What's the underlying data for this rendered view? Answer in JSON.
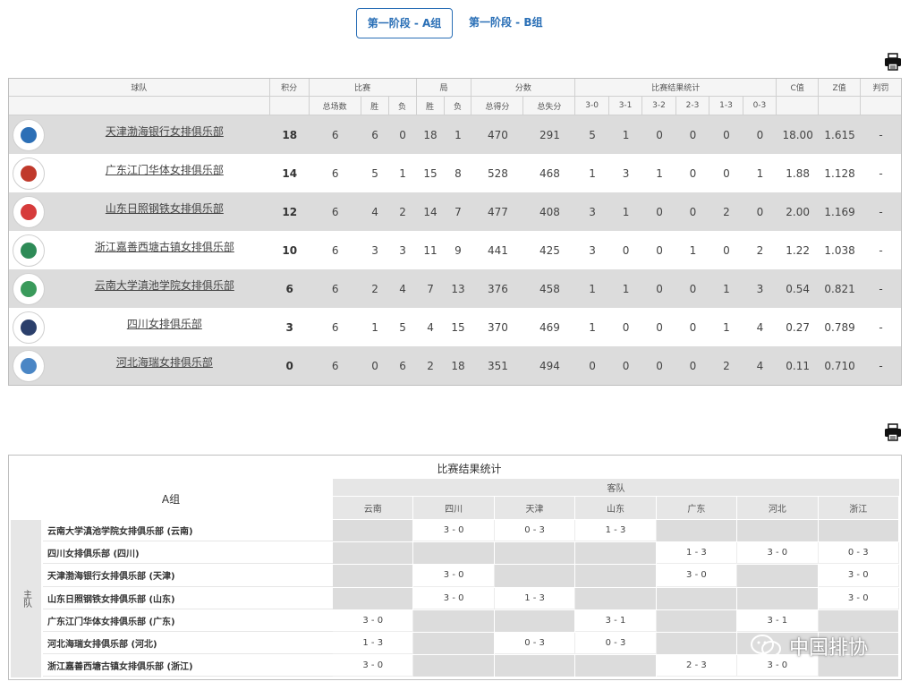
{
  "tabs": [
    {
      "label": "第一阶段 - A组",
      "active": true
    },
    {
      "label": "第一阶段 - B组",
      "active": false
    }
  ],
  "standings": {
    "headers_top": {
      "team": "球队",
      "points": "积分",
      "matches": "比赛",
      "games": "局",
      "score": "分数",
      "results": "比赛结果统计",
      "c": "C值",
      "z": "Z值",
      "penalty": "判罚"
    },
    "headers_sub": {
      "total": "总场数",
      "win": "胜",
      "lose": "负",
      "gwin": "胜",
      "glose": "负",
      "pts_for": "总得分",
      "pts_against": "总失分",
      "r30": "3-0",
      "r31": "3-1",
      "r32": "3-2",
      "r23": "2-3",
      "r13": "1-3",
      "r03": "0-3"
    },
    "rows": [
      {
        "team": "天津渤海银行女排俱乐部",
        "pts": "18",
        "total": "6",
        "w": "6",
        "l": "0",
        "gw": "18",
        "gl": "1",
        "pf": "470",
        "pa": "291",
        "r30": "5",
        "r31": "1",
        "r32": "0",
        "r23": "0",
        "r13": "0",
        "r03": "0",
        "c": "18.00",
        "z": "1.615",
        "pen": "-",
        "logo_color": "#2c6fb6"
      },
      {
        "team": "广东江门华体女排俱乐部",
        "pts": "14",
        "total": "6",
        "w": "5",
        "l": "1",
        "gw": "15",
        "gl": "8",
        "pf": "528",
        "pa": "468",
        "r30": "1",
        "r31": "3",
        "r32": "1",
        "r23": "0",
        "r13": "0",
        "r03": "1",
        "c": "1.88",
        "z": "1.128",
        "pen": "-",
        "logo_color": "#c0392b"
      },
      {
        "team": "山东日照钢铁女排俱乐部",
        "pts": "12",
        "total": "6",
        "w": "4",
        "l": "2",
        "gw": "14",
        "gl": "7",
        "pf": "477",
        "pa": "408",
        "r30": "3",
        "r31": "1",
        "r32": "0",
        "r23": "0",
        "r13": "2",
        "r03": "0",
        "c": "2.00",
        "z": "1.169",
        "pen": "-",
        "logo_color": "#d63b3b"
      },
      {
        "team": "浙江嘉善西塘古镇女排俱乐部",
        "pts": "10",
        "total": "6",
        "w": "3",
        "l": "3",
        "gw": "11",
        "gl": "9",
        "pf": "441",
        "pa": "425",
        "r30": "3",
        "r31": "0",
        "r32": "0",
        "r23": "1",
        "r13": "0",
        "r03": "2",
        "c": "1.22",
        "z": "1.038",
        "pen": "-",
        "logo_color": "#2e8b57"
      },
      {
        "team": "云南大学滇池学院女排俱乐部",
        "pts": "6",
        "total": "6",
        "w": "2",
        "l": "4",
        "gw": "7",
        "gl": "13",
        "pf": "376",
        "pa": "458",
        "r30": "1",
        "r31": "1",
        "r32": "0",
        "r23": "0",
        "r13": "1",
        "r03": "3",
        "c": "0.54",
        "z": "0.821",
        "pen": "-",
        "logo_color": "#3a9a5b"
      },
      {
        "team": "四川女排俱乐部",
        "pts": "3",
        "total": "6",
        "w": "1",
        "l": "5",
        "gw": "4",
        "gl": "15",
        "pf": "370",
        "pa": "469",
        "r30": "1",
        "r31": "0",
        "r32": "0",
        "r23": "0",
        "r13": "1",
        "r03": "4",
        "c": "0.27",
        "z": "0.789",
        "pen": "-",
        "logo_color": "#2b3f6b"
      },
      {
        "team": "河北海瑞女排俱乐部",
        "pts": "0",
        "total": "6",
        "w": "0",
        "l": "6",
        "gw": "2",
        "gl": "18",
        "pf": "351",
        "pa": "494",
        "r30": "0",
        "r31": "0",
        "r32": "0",
        "r23": "0",
        "r13": "2",
        "r03": "4",
        "c": "0.11",
        "z": "0.710",
        "pen": "-",
        "logo_color": "#4a86c5"
      }
    ]
  },
  "matrix": {
    "title": "比赛结果统计",
    "group": "A组",
    "guest_label": "客队",
    "home_label": "主队",
    "columns": [
      "云南",
      "四川",
      "天津",
      "山东",
      "广东",
      "河北",
      "浙江"
    ],
    "rows": [
      {
        "name": "云南大学滇池学院女排俱乐部 (云南)",
        "cells": [
          "",
          "3 - 0",
          "0 - 3",
          "1 - 3",
          "",
          "",
          ""
        ]
      },
      {
        "name": "四川女排俱乐部 (四川)",
        "cells": [
          "",
          "",
          "",
          "",
          "1 - 3",
          "3 - 0",
          "0 - 3"
        ]
      },
      {
        "name": "天津渤海银行女排俱乐部 (天津)",
        "cells": [
          "",
          "3 - 0",
          "",
          "",
          "3 - 0",
          "",
          "3 - 0"
        ]
      },
      {
        "name": "山东日照钢铁女排俱乐部 (山东)",
        "cells": [
          "",
          "3 - 0",
          "1 - 3",
          "",
          "",
          "",
          "3 - 0"
        ]
      },
      {
        "name": "广东江门华体女排俱乐部 (广东)",
        "cells": [
          "3 - 0",
          "",
          "",
          "3 - 1",
          "",
          "3 - 1",
          ""
        ]
      },
      {
        "name": "河北海瑞女排俱乐部 (河北)",
        "cells": [
          "1 - 3",
          "",
          "0 - 3",
          "0 - 3",
          "",
          "",
          ""
        ]
      },
      {
        "name": "浙江嘉善西塘古镇女排俱乐部 (浙江)",
        "cells": [
          "3 - 0",
          "",
          "",
          "",
          "2 - 3",
          "3 - 0",
          ""
        ]
      }
    ]
  },
  "watermark": "中国排协",
  "icons": {
    "print": "printer-icon",
    "wechat": "wechat-icon"
  }
}
